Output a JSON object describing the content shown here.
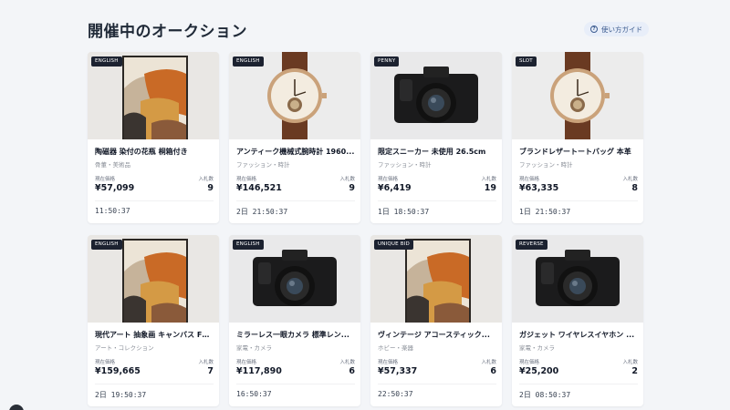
{
  "page": {
    "title": "開催中のオークション",
    "guide_label": "使い方ガイド"
  },
  "labels": {
    "price": "現在価格",
    "bids": "入札数"
  },
  "auctions": [
    {
      "tag": "ENGLISH",
      "image": "abstract-art",
      "title": "陶磁器 染付の花瓶 桐箱付き",
      "category": "骨董・美術品",
      "price": "¥57,099",
      "bids": "9",
      "time_left": "11:50:37"
    },
    {
      "tag": "ENGLISH",
      "image": "watch",
      "title": "アンティーク機械式腕時計 1960...",
      "category": "ファッション・時計",
      "price": "¥146,521",
      "bids": "9",
      "time_left": "2日 21:50:37"
    },
    {
      "tag": "PENNY",
      "image": "camera",
      "title": "限定スニーカー 未使用 26.5cm",
      "category": "ファッション・時計",
      "price": "¥6,419",
      "bids": "19",
      "time_left": "1日 18:50:37"
    },
    {
      "tag": "SLOT",
      "image": "watch",
      "title": "ブランドレザートートバッグ 本革",
      "category": "ファッション・時計",
      "price": "¥63,335",
      "bids": "8",
      "time_left": "1日 21:50:37"
    },
    {
      "tag": "ENGLISH",
      "image": "abstract-art",
      "title": "現代アート 抽象画 キャンバス F2...",
      "category": "アート・コレクション",
      "price": "¥159,665",
      "bids": "7",
      "time_left": "2日 19:50:37"
    },
    {
      "tag": "ENGLISH",
      "image": "camera",
      "title": "ミラーレス一眼カメラ 標準レン...",
      "category": "家電・カメラ",
      "price": "¥117,890",
      "bids": "6",
      "time_left": "16:50:37"
    },
    {
      "tag": "UNIQUE BID",
      "image": "abstract-art",
      "title": "ヴィンテージ アコースティック...",
      "category": "ホビー・楽器",
      "price": "¥57,337",
      "bids": "6",
      "time_left": "22:50:37"
    },
    {
      "tag": "REVERSE",
      "image": "camera",
      "title": "ガジェット ワイヤレスイヤホン ...",
      "category": "家電・カメラ",
      "price": "¥25,200",
      "bids": "2",
      "time_left": "2日 08:50:37"
    }
  ]
}
